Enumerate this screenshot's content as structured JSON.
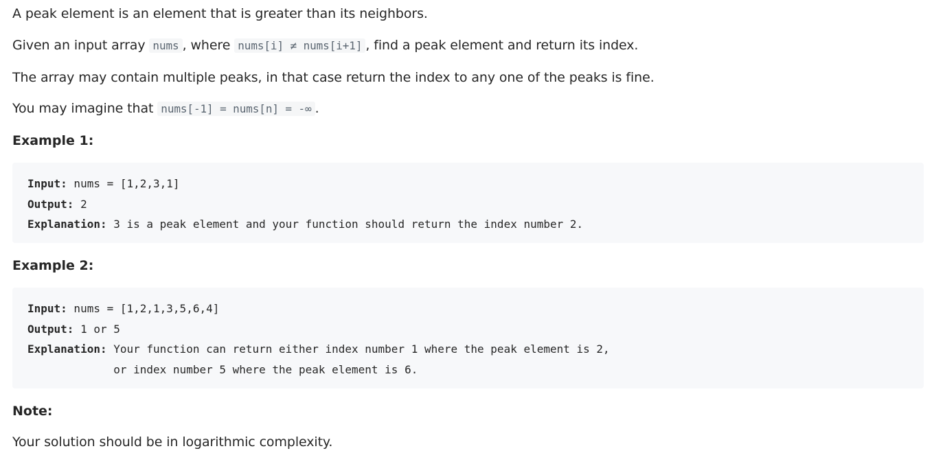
{
  "intro": {
    "line1": "A peak element is an element that is greater than its neighbors.",
    "line2_pre": "Given an input array ",
    "line2_code1": "nums",
    "line2_mid": ", where ",
    "line2_code2": "nums[i] ≠ nums[i+1]",
    "line2_post": ", find a peak element and return its index.",
    "line3": "The array may contain multiple peaks, in that case return the index to any one of the peaks is fine.",
    "line4_pre": "You may imagine that ",
    "line4_code": "nums[-1] = nums[n] = -∞",
    "line4_post": "."
  },
  "example1": {
    "heading": "Example 1:",
    "input_label": "Input:",
    "input_value": " nums = [1,2,3,1]",
    "output_label": "Output:",
    "output_value": " 2",
    "explanation_label": "Explanation:",
    "explanation_value": " 3 is a peak element and your function should return the index number 2."
  },
  "example2": {
    "heading": "Example 2:",
    "input_label": "Input:",
    "input_value": " nums = [1,2,1,3,5,6,4]",
    "output_label": "Output:",
    "output_value": " 1 or 5",
    "explanation_label": "Explanation:",
    "explanation_value": " Your function can return either index number 1 where the peak element is 2,",
    "explanation_cont": "             or index number 5 where the peak element is 6."
  },
  "note": {
    "heading": "Note:",
    "text": "Your solution should be in logarithmic complexity."
  }
}
